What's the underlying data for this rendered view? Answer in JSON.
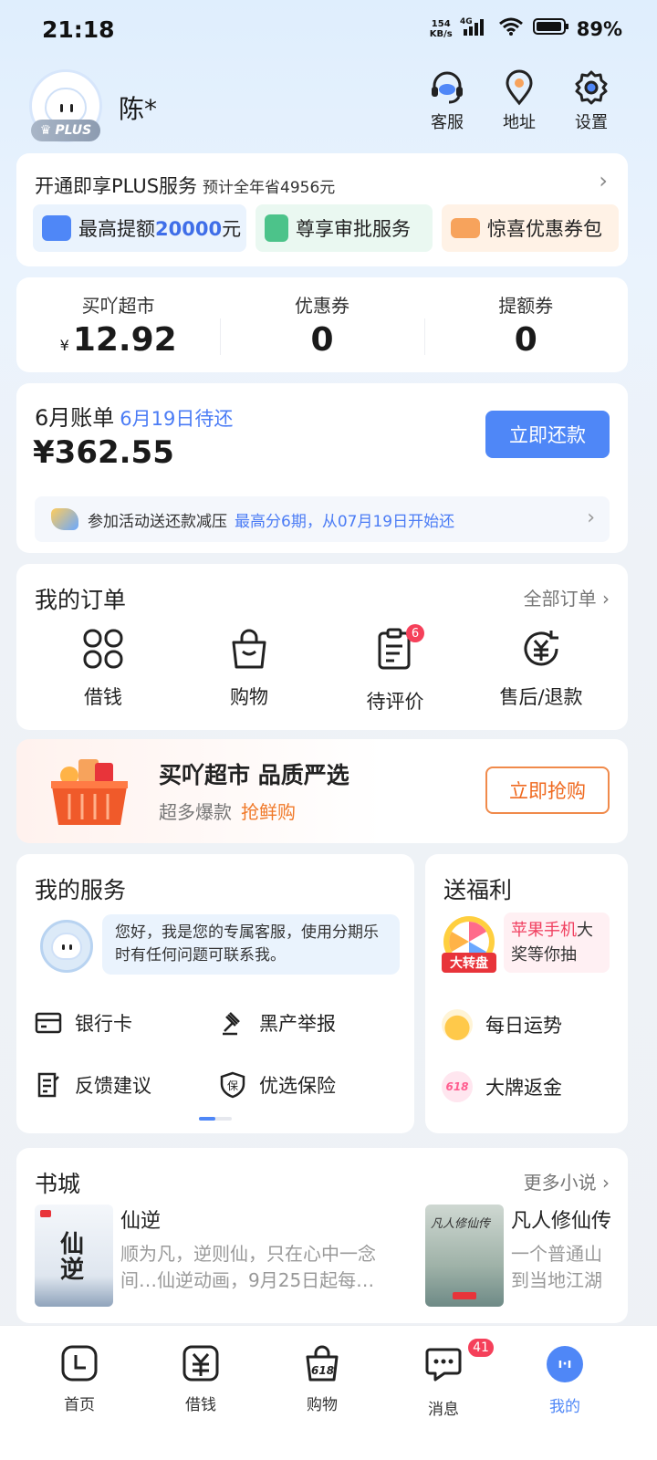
{
  "status_bar": {
    "time": "21:18",
    "net_speed_top": "154",
    "net_speed_bottom": "KB/s",
    "network": "4G",
    "battery": "89%"
  },
  "header": {
    "user_name": "陈*",
    "plus_badge": "PLUS",
    "buttons": [
      {
        "label": "客服",
        "icon": "headset-icon"
      },
      {
        "label": "地址",
        "icon": "location-pin-icon"
      },
      {
        "label": "设置",
        "icon": "gear-icon"
      }
    ]
  },
  "plus_card": {
    "title": "开通即享PLUS服务",
    "subtitle": "预计全年省4956元",
    "tags": [
      {
        "prefix": "最高提额",
        "highlight": "20000",
        "suffix": "元",
        "bg": "#eaf3fd",
        "icon_color": "#4f87f7"
      },
      {
        "label": "尊享审批服务",
        "bg": "#eaf8f1",
        "icon_color": "#4cc38a"
      },
      {
        "label": "惊喜优惠券包",
        "bg": "#fff2e6",
        "icon_color": "#f7a35c"
      }
    ]
  },
  "stats": [
    {
      "label": "买吖超市",
      "currency": "¥",
      "value": "12.92"
    },
    {
      "label": "优惠券",
      "value": "0"
    },
    {
      "label": "提额券",
      "value": "0"
    }
  ],
  "bill": {
    "title": "6月账单",
    "due": "6月19日待还",
    "amount": "¥362.55",
    "repay_label": "立即还款",
    "promo_text": "参加活动送还款减压",
    "promo_highlight": "最高分6期，从07月19日开始还"
  },
  "orders": {
    "title": "我的订单",
    "more": "全部订单",
    "items": [
      {
        "label": "借钱",
        "icon": "borrow-grid-icon"
      },
      {
        "label": "购物",
        "icon": "shopping-bag-icon"
      },
      {
        "label": "待评价",
        "icon": "clipboard-icon",
        "badge": "6"
      },
      {
        "label": "售后/退款",
        "icon": "refund-yen-icon"
      }
    ]
  },
  "banner": {
    "title": "买吖超市 品质严选",
    "subtitle": "超多爆款",
    "highlight": "抢鲜购",
    "button": "立即抢购"
  },
  "services": {
    "title": "我的服务",
    "greeting": "您好，我是您的专属客服，使用分期乐时有任何问题可联系我。",
    "items": [
      {
        "label": "银行卡",
        "icon": "bank-card-icon"
      },
      {
        "label": "黑产举报",
        "icon": "gavel-icon"
      },
      {
        "label": "反馈建议",
        "icon": "feedback-icon"
      },
      {
        "label": "优选保险",
        "icon": "insurance-shield-icon"
      }
    ]
  },
  "benefits": {
    "title": "送福利",
    "wheel_label": "大转盘",
    "prize_highlight": "苹果手机",
    "prize_text": "大奖等你抽",
    "items": [
      {
        "label": "每日运势",
        "icon": "gold-ingot-icon"
      },
      {
        "label": "大牌返金",
        "icon": "618-badge-icon",
        "icon_text": "618"
      }
    ]
  },
  "books": {
    "title": "书城",
    "more": "更多小说",
    "items": [
      {
        "title": "仙逆",
        "desc1": "顺为凡，逆则仙，只在心中一念",
        "desc2": "间…仙逆动画，9月25日起每…"
      },
      {
        "title": "凡人修仙传",
        "desc1": "一个普通山",
        "desc2": "到当地江湖"
      }
    ]
  },
  "tabbar": [
    {
      "label": "首页",
      "icon": "home-clock-icon"
    },
    {
      "label": "借钱",
      "icon": "yen-card-icon"
    },
    {
      "label": "购物",
      "icon": "618-bag-icon"
    },
    {
      "label": "消息",
      "icon": "chat-bubble-icon",
      "badge": "41"
    },
    {
      "label": "我的",
      "icon": "profile-face-icon",
      "active": true
    }
  ],
  "colors": {
    "accent": "#4f87f7",
    "accent_text": "#4b7cf5",
    "badge_red": "#f5405a",
    "orange": "#ef6a20"
  }
}
